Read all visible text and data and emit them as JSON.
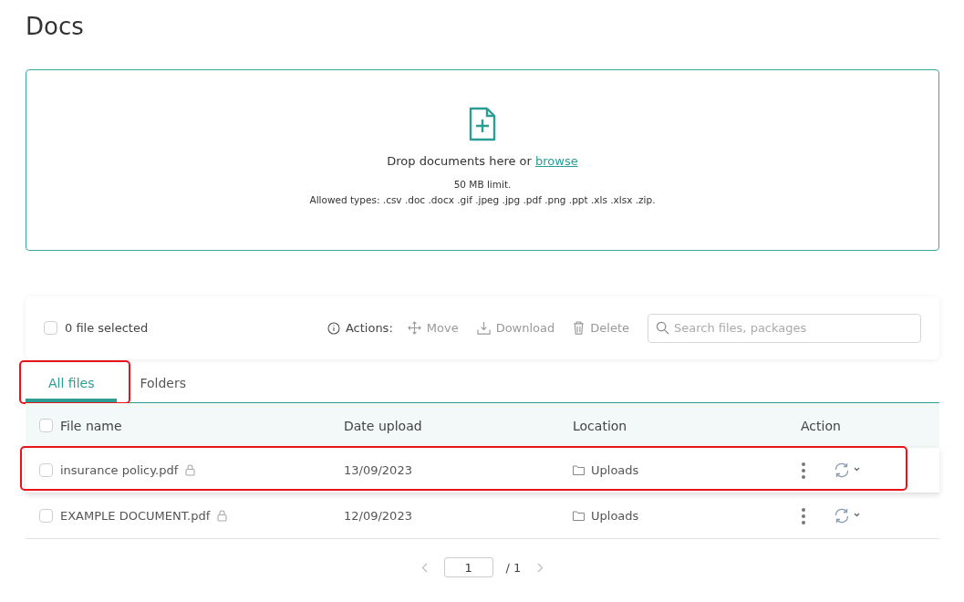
{
  "page": {
    "title": "Docs"
  },
  "upload": {
    "prompt": "Drop documents here or",
    "link": "browse",
    "limit": "50 MB limit.",
    "allowed": "Allowed types: .csv .doc .docx .gif .jpeg .jpg .pdf .png .ppt .xls .xlsx .zip."
  },
  "toolbar": {
    "select_all": {
      "checked": false,
      "label": "0 file selected"
    },
    "actions_label": "Actions:",
    "actions": [
      {
        "kind": "move",
        "label": "Move",
        "disabled": true
      },
      {
        "kind": "download",
        "label": "Download",
        "disabled": true
      },
      {
        "kind": "delete",
        "label": "Delete",
        "disabled": true
      }
    ],
    "search": {
      "placeholder": "Search files, packages"
    }
  },
  "tabs": [
    {
      "label": "All files",
      "selected": true,
      "highlighted": true
    },
    {
      "label": "Folders",
      "selected": false,
      "highlighted": false
    }
  ],
  "table": {
    "columns": [
      "File name",
      "Date upload",
      "Location",
      "Action"
    ],
    "header_checked": false,
    "rows": [
      {
        "name": "insurance policy.pdf",
        "locked": true,
        "date": "13/09/2023",
        "location": "Uploads",
        "checked": false,
        "highlighted": true
      },
      {
        "name": "EXAMPLE DOCUMENT.pdf",
        "locked": true,
        "date": "12/09/2023",
        "location": "Uploads",
        "checked": false,
        "highlighted": false
      }
    ]
  },
  "pagination": {
    "page": "1",
    "total": "/ 1"
  }
}
